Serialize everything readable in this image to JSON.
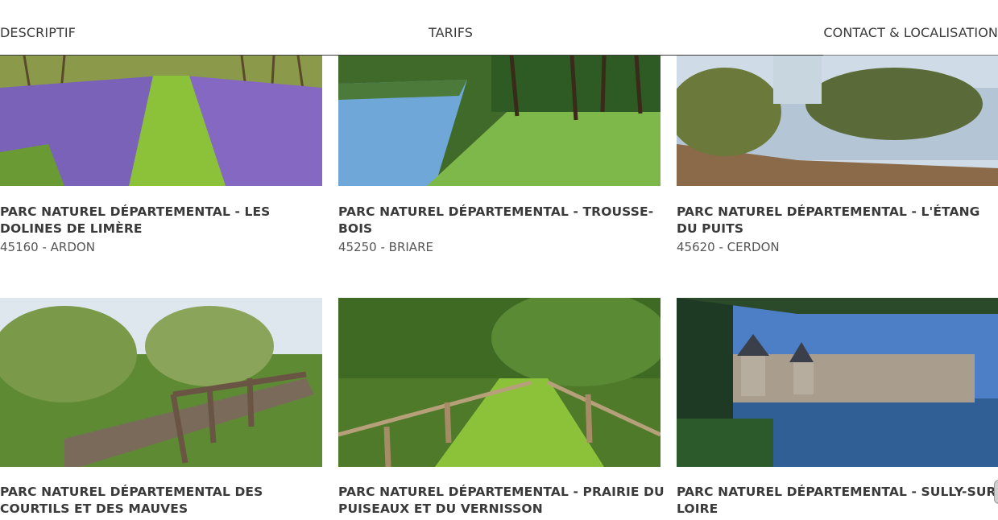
{
  "tabs": [
    {
      "label": "DESCRIPTIF"
    },
    {
      "label": "TARIFS"
    },
    {
      "label": "CONTACT & LOCALISATION"
    }
  ],
  "cards": [
    {
      "title": "PARC NATUREL DÉPARTEMENTAL - LES DOLINES DE LIMÈRE",
      "location": "45160 - ARDON"
    },
    {
      "title": "PARC NATUREL DÉPARTEMENTAL - TROUSSE-BOIS",
      "location": "45250 - BRIARE"
    },
    {
      "title": "PARC NATUREL DÉPARTEMENTAL - L'ÉTANG DU PUITS",
      "location": "45620 - CERDON"
    },
    {
      "title": "PARC NATUREL DÉPARTEMENTAL DES COURTILS ET DES MAUVES",
      "location": ""
    },
    {
      "title": "PARC NATUREL DÉPARTEMENTAL - PRAIRIE DU PUISEAUX ET DU VERNISSON",
      "location": ""
    },
    {
      "title": "PARC NATUREL DÉPARTEMENTAL - SULLY-SUR-LOIRE",
      "location": ""
    }
  ]
}
